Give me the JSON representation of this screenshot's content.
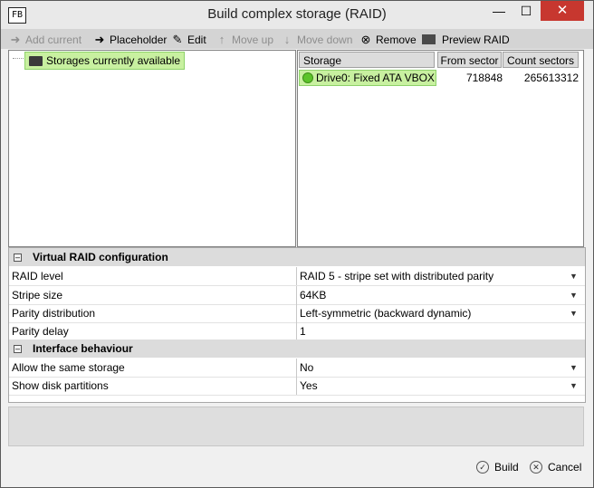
{
  "window": {
    "app_icon": "FB",
    "title": "Build complex storage (RAID)",
    "controls": {
      "minimize": "—",
      "maximize": "☐",
      "close": "✕"
    }
  },
  "toolbar": {
    "add_current": "Add current",
    "placeholder": "Placeholder",
    "edit": "Edit",
    "move_up": "Move up",
    "move_down": "Move down",
    "remove": "Remove",
    "preview_raid": "Preview RAID"
  },
  "tree": {
    "root_label": "Storages currently available"
  },
  "grid": {
    "columns": [
      "Storage",
      "From sector",
      "Count sectors"
    ],
    "rows": [
      {
        "storage": "Drive0: Fixed ATA VBOX ...",
        "from_sector": "718848",
        "count_sectors": "265613312"
      }
    ]
  },
  "properties": {
    "sections": [
      {
        "title": "Virtual RAID configuration",
        "rows": [
          {
            "key": "RAID level",
            "value": "RAID 5 - stripe set with distributed parity"
          },
          {
            "key": "Stripe size",
            "value": "64KB"
          },
          {
            "key": "Parity distribution",
            "value": "Left-symmetric (backward dynamic)"
          },
          {
            "key": "Parity delay",
            "value": "1"
          }
        ]
      },
      {
        "title": "Interface behaviour",
        "rows": [
          {
            "key": "Allow the same storage",
            "value": "No"
          },
          {
            "key": "Show disk partitions",
            "value": "Yes"
          }
        ]
      }
    ],
    "collapse_glyph": "–",
    "dropdown_glyph": "▼"
  },
  "buttons": {
    "build": "Build",
    "cancel": "Cancel"
  },
  "icons": {
    "check": "✓",
    "x": "✕"
  }
}
